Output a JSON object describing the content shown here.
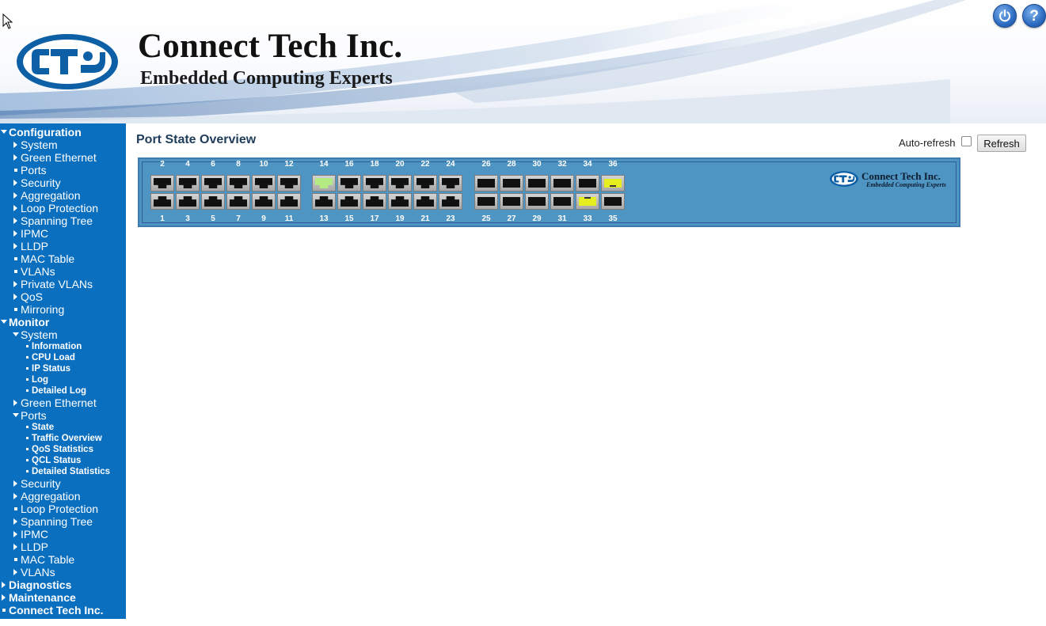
{
  "header": {
    "brand_name": "Connect Tech Inc.",
    "tagline": "Embedded Computing Experts",
    "buttons": [
      {
        "name": "logout",
        "icon": "power-icon"
      },
      {
        "name": "help",
        "icon": "help-icon",
        "glyph": "?"
      }
    ],
    "colors": {
      "button_blue": "#2d6cc2"
    }
  },
  "sidebar": {
    "color": "#0a6fbf",
    "items": [
      {
        "label": "Configuration",
        "level": 0,
        "marker": "down"
      },
      {
        "label": "System",
        "level": 1,
        "marker": "right"
      },
      {
        "label": "Green Ethernet",
        "level": 1,
        "marker": "right"
      },
      {
        "label": "Ports",
        "level": 1,
        "marker": "leaf"
      },
      {
        "label": "Security",
        "level": 1,
        "marker": "right"
      },
      {
        "label": "Aggregation",
        "level": 1,
        "marker": "right"
      },
      {
        "label": "Loop Protection",
        "level": 1,
        "marker": "right"
      },
      {
        "label": "Spanning Tree",
        "level": 1,
        "marker": "right"
      },
      {
        "label": "IPMC",
        "level": 1,
        "marker": "right"
      },
      {
        "label": "LLDP",
        "level": 1,
        "marker": "right"
      },
      {
        "label": "MAC Table",
        "level": 1,
        "marker": "leaf"
      },
      {
        "label": "VLANs",
        "level": 1,
        "marker": "leaf"
      },
      {
        "label": "Private VLANs",
        "level": 1,
        "marker": "right"
      },
      {
        "label": "QoS",
        "level": 1,
        "marker": "right"
      },
      {
        "label": "Mirroring",
        "level": 1,
        "marker": "leaf"
      },
      {
        "label": "Monitor",
        "level": 0,
        "marker": "down"
      },
      {
        "label": "System",
        "level": 1,
        "marker": "down"
      },
      {
        "label": "Information",
        "level": 2,
        "marker": "leaf"
      },
      {
        "label": "CPU Load",
        "level": 2,
        "marker": "leaf"
      },
      {
        "label": "IP Status",
        "level": 2,
        "marker": "leaf"
      },
      {
        "label": "Log",
        "level": 2,
        "marker": "leaf"
      },
      {
        "label": "Detailed Log",
        "level": 2,
        "marker": "leaf"
      },
      {
        "label": "Green Ethernet",
        "level": 1,
        "marker": "right"
      },
      {
        "label": "Ports",
        "level": 1,
        "marker": "down"
      },
      {
        "label": "State",
        "level": 2,
        "marker": "leaf"
      },
      {
        "label": "Traffic Overview",
        "level": 2,
        "marker": "leaf"
      },
      {
        "label": "QoS Statistics",
        "level": 2,
        "marker": "leaf"
      },
      {
        "label": "QCL Status",
        "level": 2,
        "marker": "leaf"
      },
      {
        "label": "Detailed Statistics",
        "level": 2,
        "marker": "leaf"
      },
      {
        "label": "Security",
        "level": 1,
        "marker": "right"
      },
      {
        "label": "Aggregation",
        "level": 1,
        "marker": "right"
      },
      {
        "label": "Loop Protection",
        "level": 1,
        "marker": "leaf"
      },
      {
        "label": "Spanning Tree",
        "level": 1,
        "marker": "right"
      },
      {
        "label": "IPMC",
        "level": 1,
        "marker": "right"
      },
      {
        "label": "LLDP",
        "level": 1,
        "marker": "right"
      },
      {
        "label": "MAC Table",
        "level": 1,
        "marker": "leaf"
      },
      {
        "label": "VLANs",
        "level": 1,
        "marker": "right"
      },
      {
        "label": "Diagnostics",
        "level": 0,
        "marker": "right"
      },
      {
        "label": "Maintenance",
        "level": 0,
        "marker": "right"
      },
      {
        "label": "Connect Tech Inc.",
        "level": 0,
        "marker": "leaf"
      }
    ]
  },
  "main": {
    "title": "Port State Overview",
    "auto_refresh_label": "Auto-refresh",
    "auto_refresh_checked": false,
    "refresh_label": "Refresh"
  },
  "switch_panel": {
    "brand": "Connect Tech Inc.",
    "tagline": "Embedded Computing Experts",
    "colors": {
      "panel": "#4f95c4",
      "rj_link": "#b4ea82",
      "sfp_link": "#e5ef1f",
      "port_down": "#111111"
    },
    "ports": [
      {
        "number": "1",
        "type": "rj45",
        "row": "bottom",
        "link": false
      },
      {
        "number": "2",
        "type": "rj45",
        "row": "top",
        "link": false
      },
      {
        "number": "3",
        "type": "rj45",
        "row": "bottom",
        "link": false
      },
      {
        "number": "4",
        "type": "rj45",
        "row": "top",
        "link": false
      },
      {
        "number": "5",
        "type": "rj45",
        "row": "bottom",
        "link": false
      },
      {
        "number": "6",
        "type": "rj45",
        "row": "top",
        "link": false
      },
      {
        "number": "7",
        "type": "rj45",
        "row": "bottom",
        "link": false
      },
      {
        "number": "8",
        "type": "rj45",
        "row": "top",
        "link": false
      },
      {
        "number": "9",
        "type": "rj45",
        "row": "bottom",
        "link": false
      },
      {
        "number": "10",
        "type": "rj45",
        "row": "top",
        "link": false
      },
      {
        "number": "11",
        "type": "rj45",
        "row": "bottom",
        "link": false
      },
      {
        "number": "12",
        "type": "rj45",
        "row": "top",
        "link": false
      },
      {
        "number": "13",
        "type": "rj45",
        "row": "bottom",
        "link": false
      },
      {
        "number": "14",
        "type": "rj45",
        "row": "top",
        "link": true
      },
      {
        "number": "15",
        "type": "rj45",
        "row": "bottom",
        "link": false
      },
      {
        "number": "16",
        "type": "rj45",
        "row": "top",
        "link": false
      },
      {
        "number": "17",
        "type": "rj45",
        "row": "bottom",
        "link": false
      },
      {
        "number": "18",
        "type": "rj45",
        "row": "top",
        "link": false
      },
      {
        "number": "19",
        "type": "rj45",
        "row": "bottom",
        "link": false
      },
      {
        "number": "20",
        "type": "rj45",
        "row": "top",
        "link": false
      },
      {
        "number": "21",
        "type": "rj45",
        "row": "bottom",
        "link": false
      },
      {
        "number": "22",
        "type": "rj45",
        "row": "top",
        "link": false
      },
      {
        "number": "23",
        "type": "rj45",
        "row": "bottom",
        "link": false
      },
      {
        "number": "24",
        "type": "rj45",
        "row": "top",
        "link": false
      },
      {
        "number": "25",
        "type": "sfp",
        "row": "bottom",
        "link": false
      },
      {
        "number": "26",
        "type": "sfp",
        "row": "top",
        "link": false
      },
      {
        "number": "27",
        "type": "sfp",
        "row": "bottom",
        "link": false
      },
      {
        "number": "28",
        "type": "sfp",
        "row": "top",
        "link": false
      },
      {
        "number": "29",
        "type": "sfp",
        "row": "bottom",
        "link": false
      },
      {
        "number": "30",
        "type": "sfp",
        "row": "top",
        "link": false
      },
      {
        "number": "31",
        "type": "sfp",
        "row": "bottom",
        "link": false
      },
      {
        "number": "32",
        "type": "sfp",
        "row": "top",
        "link": false
      },
      {
        "number": "33",
        "type": "sfp",
        "row": "bottom",
        "link": true
      },
      {
        "number": "34",
        "type": "sfp",
        "row": "top",
        "link": false
      },
      {
        "number": "35",
        "type": "sfp",
        "row": "bottom",
        "link": false
      },
      {
        "number": "36",
        "type": "sfp",
        "row": "top",
        "link": true
      }
    ]
  }
}
